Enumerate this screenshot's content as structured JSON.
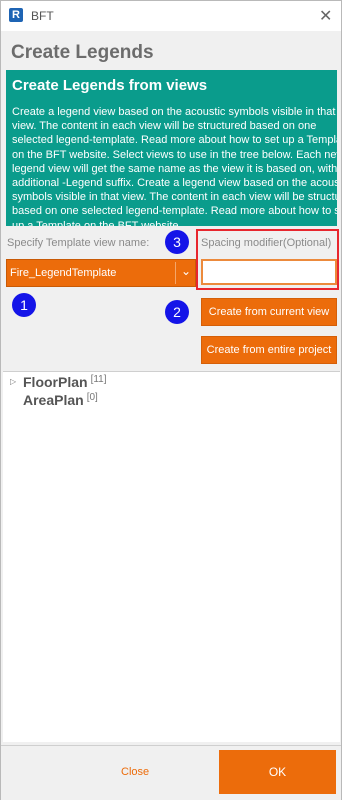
{
  "window": {
    "app_icon_letter": "R",
    "title": "BFT",
    "close_glyph": "✕"
  },
  "heading": "Create Legends",
  "info": {
    "title": "Create Legends from views",
    "body": "Create a legend view based on the acoustic symbols visible in that view. The content in each view will be structured based on one selected legend-template. Read more about how to set up a Template on the BFT website. Select views to use in the tree below. Each new legend view will get the same name as the view it is based on, with an additional -Legend suffix. Create a legend view based on the acoustic symbols visible in that view. The content in each view will be structured based on one selected legend-template. Read more about how to set up a Template on the BFT website."
  },
  "template_label": "Specify Template view name:",
  "template_value": "Fire_LegendTemplate",
  "combo_arrow": "⌄",
  "spacing_label": "Spacing modifier(Optional)",
  "spacing_value": "",
  "buttons": {
    "current_view": "Create from current view",
    "entire_project": "Create from entire project"
  },
  "badges": {
    "one": "1",
    "two": "2",
    "three": "3"
  },
  "tree": [
    {
      "name": "FloorPlan",
      "count": "[11]",
      "expandable": true,
      "arrow": "▷"
    },
    {
      "name": "AreaPlan",
      "count": "[0]",
      "expandable": false,
      "arrow": ""
    }
  ],
  "footer": {
    "close": "Close",
    "ok": "OK"
  },
  "colors": {
    "accent": "#ec6c0b",
    "info_bg": "#0a9c8c",
    "badge": "#1414e8",
    "highlight": "#e8262e"
  }
}
